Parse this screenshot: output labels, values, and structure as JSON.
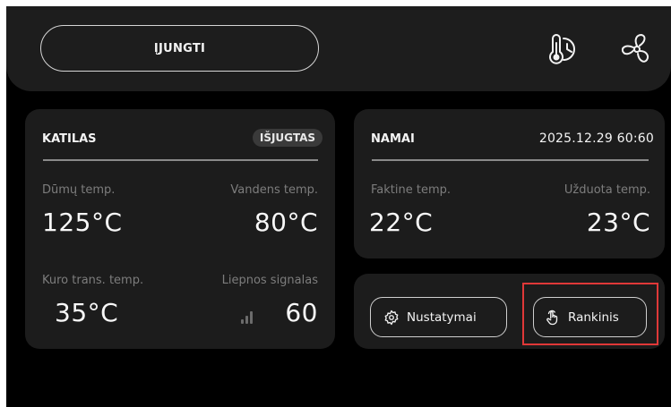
{
  "topbar": {
    "power_label": "ĮJUNGTI",
    "icons": [
      "thermometer-clock-icon",
      "fan-icon"
    ]
  },
  "boiler": {
    "title": "KATILAS",
    "status": "IŠJUGTAS",
    "smoke_label": "Dūmų temp.",
    "smoke_value": "125°C",
    "water_label": "Vandens temp.",
    "water_value": "80°C",
    "fuel_label": "Kuro trans. temp.",
    "fuel_value": "35°C",
    "flame_label": "Liepnos signalas",
    "flame_value": "60"
  },
  "home": {
    "title": "NAMAI",
    "datetime": "2025.12.29  60:60",
    "actual_label": "Faktine temp.",
    "actual_value": "22°C",
    "set_label": "Užduota temp.",
    "set_value": "23°C"
  },
  "actions": {
    "settings_label": "Nustatymai",
    "manual_label": "Rankinis"
  },
  "colors": {
    "background": "#000000",
    "card": "#1c1c1c",
    "highlight": "#e03838"
  }
}
